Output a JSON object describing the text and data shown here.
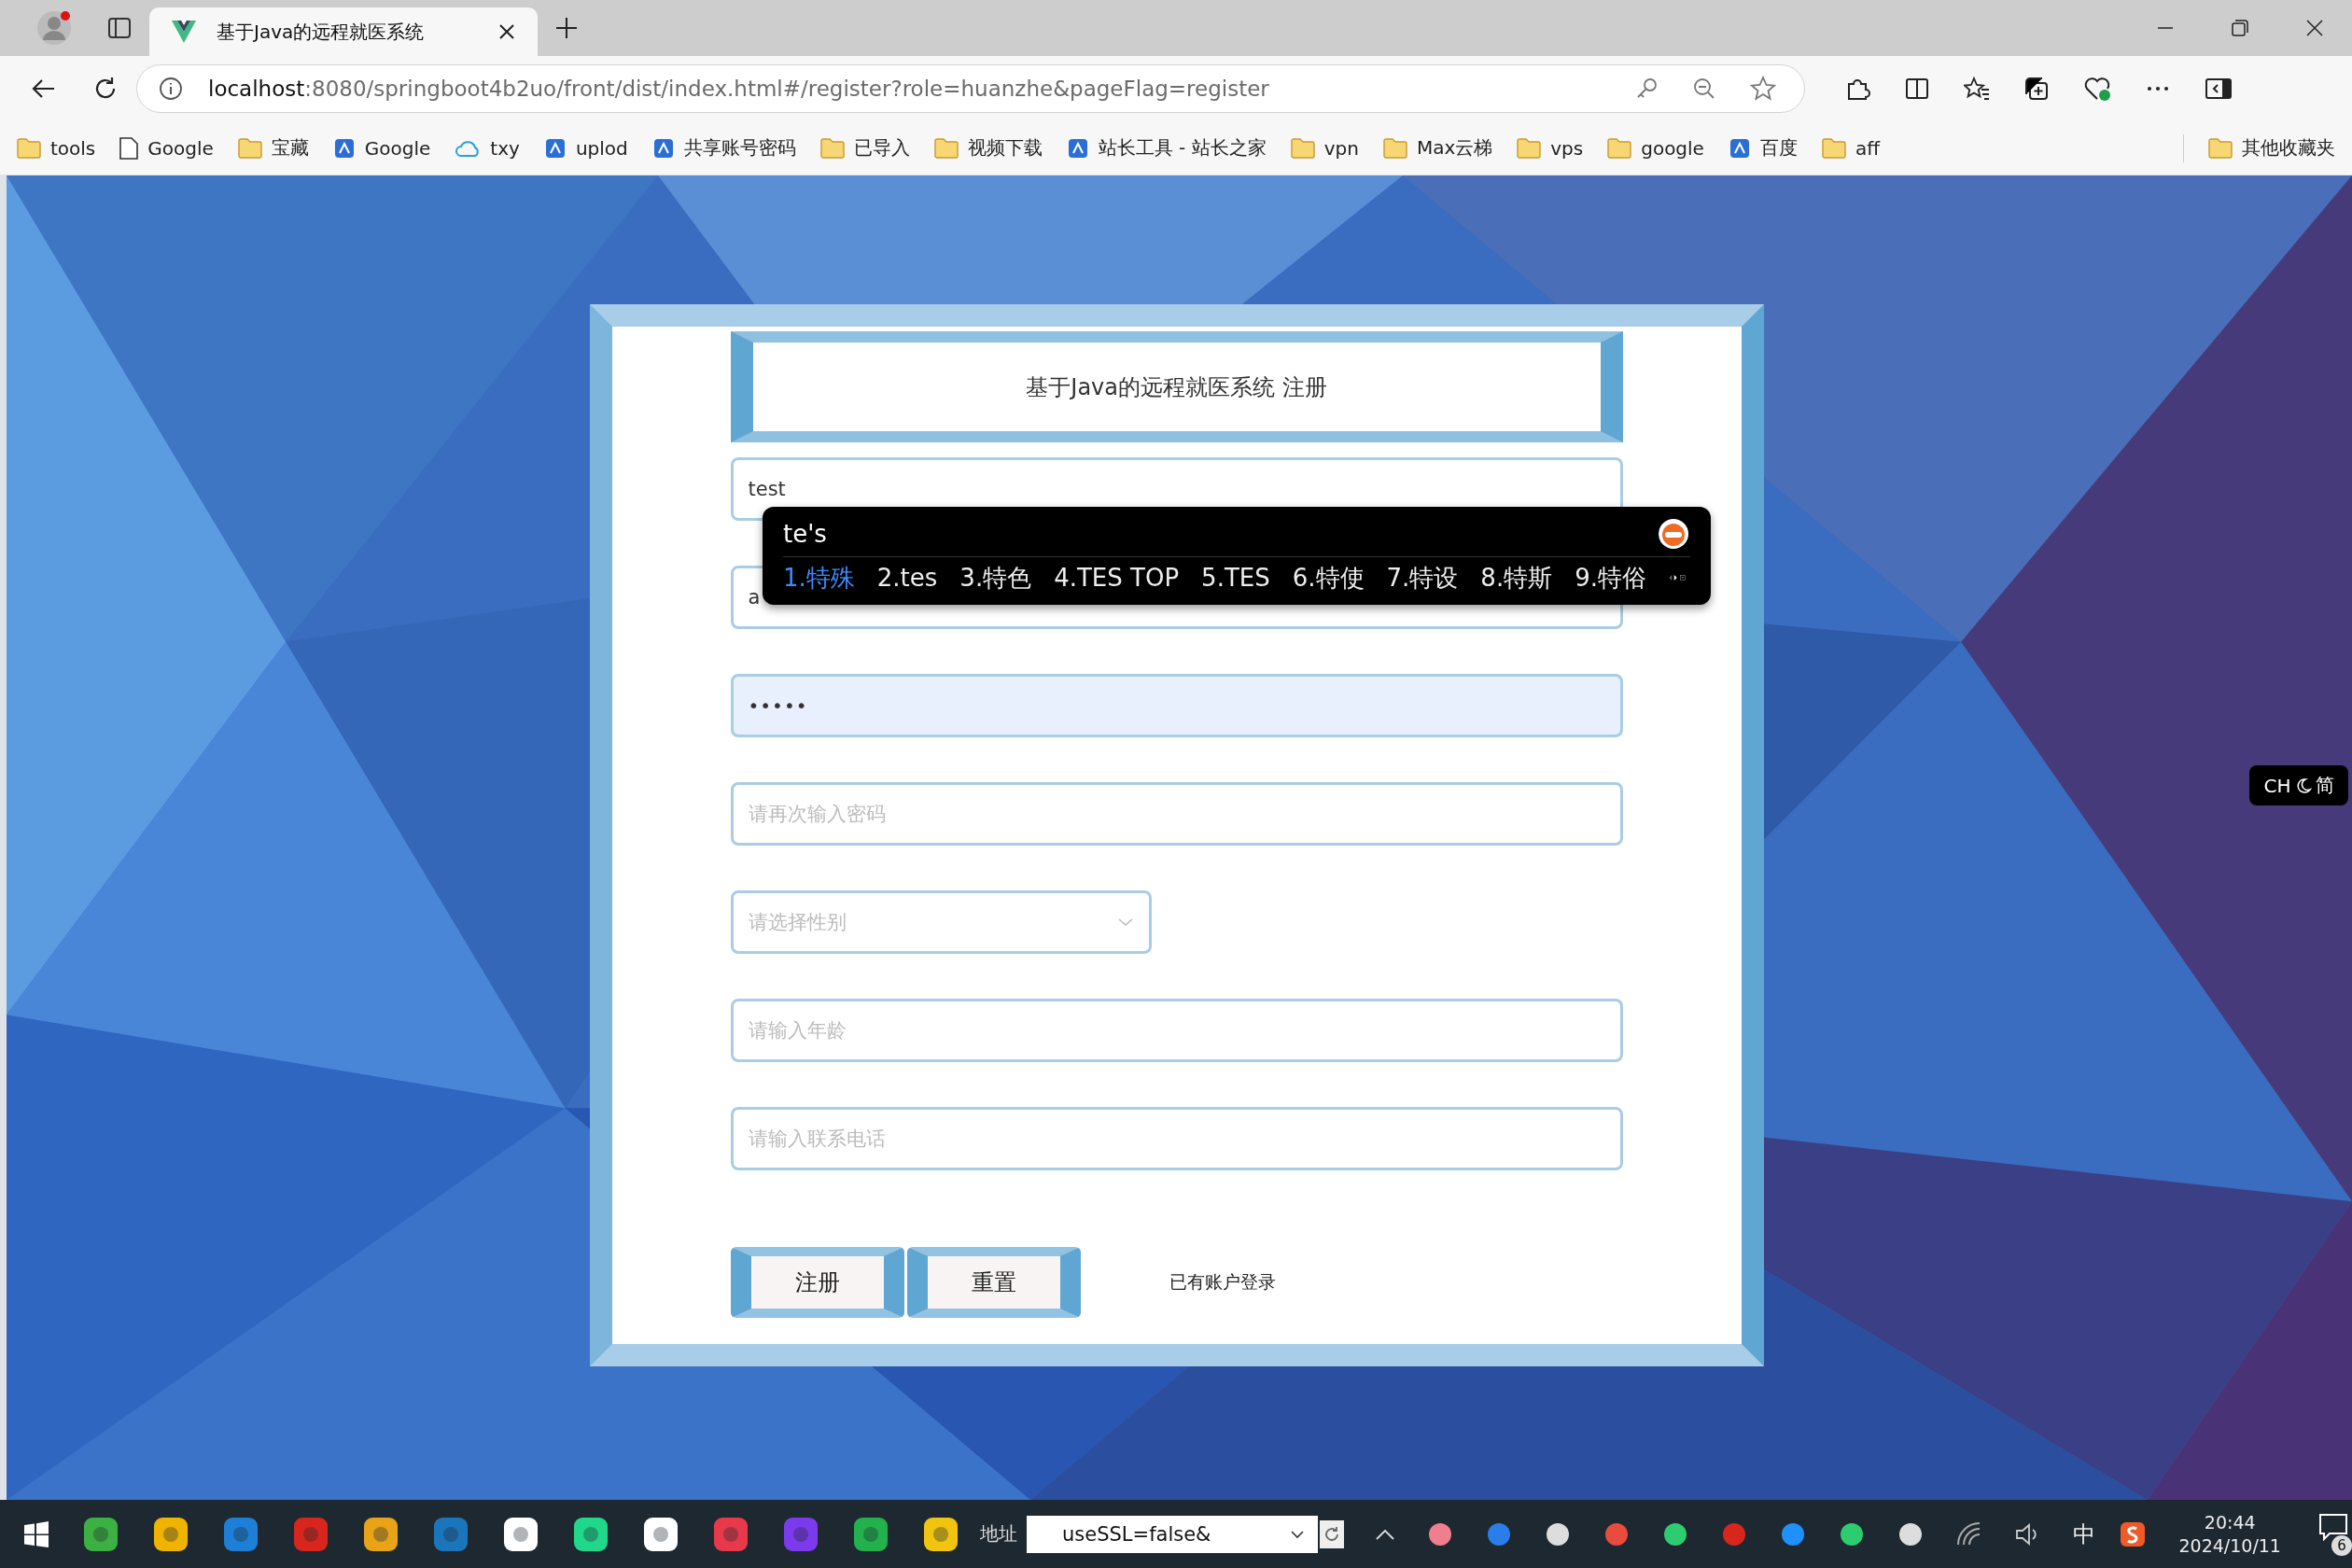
{
  "browser": {
    "tab": {
      "title": "基于Java的远程就医系统"
    },
    "address": {
      "host": "localhost",
      "rest": ":8080/springboot4b2uo/front/dist/index.html#/register?role=huanzhe&pageFlag=register"
    },
    "bookmarks": [
      {
        "label": "tools",
        "kind": "folder"
      },
      {
        "label": "Google",
        "kind": "page"
      },
      {
        "label": "宝藏",
        "kind": "folder"
      },
      {
        "label": "Google",
        "kind": "site"
      },
      {
        "label": "txy",
        "kind": "cloud"
      },
      {
        "label": "uplod",
        "kind": "site"
      },
      {
        "label": "共享账号密码",
        "kind": "site"
      },
      {
        "label": "已导入",
        "kind": "folder"
      },
      {
        "label": "视频下载",
        "kind": "folder"
      },
      {
        "label": "站长工具 - 站长之家",
        "kind": "site"
      },
      {
        "label": "vpn",
        "kind": "folder"
      },
      {
        "label": "Max云梯",
        "kind": "folder"
      },
      {
        "label": "vps",
        "kind": "folder"
      },
      {
        "label": "google",
        "kind": "folder"
      },
      {
        "label": "百度",
        "kind": "site"
      },
      {
        "label": "aff",
        "kind": "folder"
      }
    ],
    "other_bookmarks": "其他收藏夹"
  },
  "form": {
    "title": "基于Java的远程就医系统 注册",
    "fields": [
      {
        "kind": "text",
        "value": "test"
      },
      {
        "kind": "text",
        "value": "a"
      },
      {
        "kind": "password",
        "value": "•••••",
        "autofilled": true
      },
      {
        "kind": "text",
        "placeholder": "请再次输入密码"
      },
      {
        "kind": "select",
        "placeholder": "请选择性别"
      },
      {
        "kind": "text",
        "placeholder": "请输入年龄"
      },
      {
        "kind": "text",
        "placeholder": "请输入联系电话"
      }
    ],
    "buttons": [
      "注册",
      "重置"
    ],
    "login_link": "已有账户登录"
  },
  "ime": {
    "input": "te's",
    "candidates": [
      {
        "text": "1.特殊",
        "selected": true
      },
      {
        "text": "2.tes",
        "selected": false
      },
      {
        "text": "3.特色",
        "selected": false
      },
      {
        "text": "4.TES TOP",
        "selected": false
      },
      {
        "text": "5.TES",
        "selected": false
      },
      {
        "text": "6.特使",
        "selected": false
      },
      {
        "text": "7.特设",
        "selected": false
      },
      {
        "text": "8.特斯",
        "selected": false
      },
      {
        "text": "9.特俗",
        "selected": false
      }
    ]
  },
  "ime_indicator": {
    "language": "CH",
    "mode": "简"
  },
  "taskbar": {
    "address_label": "地址",
    "address_value": "useSSL=false&",
    "input_method": "中",
    "time": "20:44",
    "date": "2024/10/11",
    "notifications": "6"
  }
}
